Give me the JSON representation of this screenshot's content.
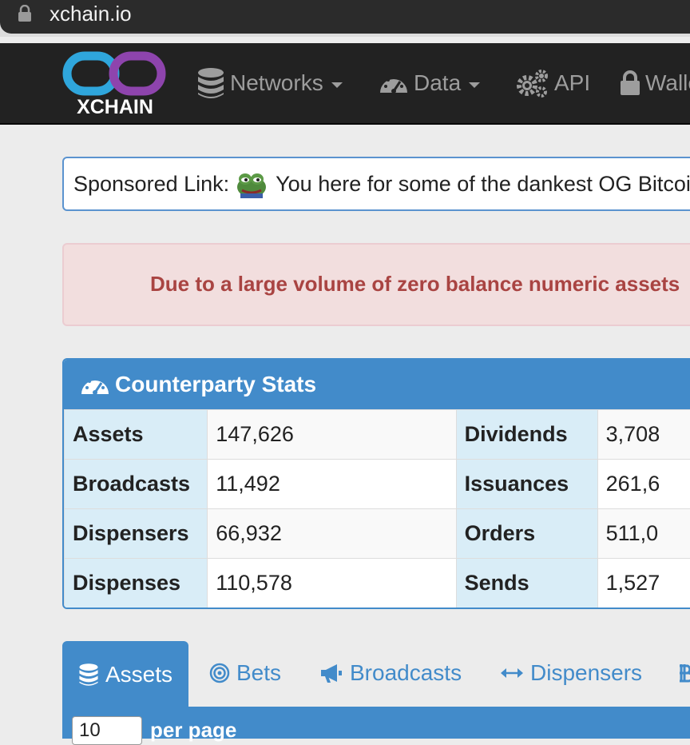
{
  "browser": {
    "url": "xchain.io"
  },
  "navbar": {
    "brand": "XCHAIN",
    "items": [
      {
        "label": "Networks",
        "icon": "database-icon",
        "dropdown": true
      },
      {
        "label": "Data",
        "icon": "dashboard-icon",
        "dropdown": true
      },
      {
        "label": "API",
        "icon": "gears-icon",
        "dropdown": false
      },
      {
        "label": "Wallet",
        "icon": "lock-icon",
        "dropdown": false
      }
    ]
  },
  "sponsored": {
    "label": "Sponsored Link:",
    "text": "You here for some of the dankest OG Bitcoin"
  },
  "alert": {
    "text": "Due to a large volume of zero balance numeric assets"
  },
  "stats": {
    "title": "Counterparty Stats",
    "rows": [
      {
        "k1": "Assets",
        "v1": "147,626",
        "k2": "Dividends",
        "v2": "3,708"
      },
      {
        "k1": "Broadcasts",
        "v1": "11,492",
        "k2": "Issuances",
        "v2": "261,6"
      },
      {
        "k1": "Dispensers",
        "v1": "66,932",
        "k2": "Orders",
        "v2": "511,0"
      },
      {
        "k1": "Dispenses",
        "v1": "110,578",
        "k2": "Sends",
        "v2": "1,527"
      }
    ]
  },
  "tabs": [
    {
      "label": "Assets",
      "icon": "database-icon",
      "active": true
    },
    {
      "label": "Bets",
      "icon": "bullseye-icon",
      "active": false
    },
    {
      "label": "Broadcasts",
      "icon": "bullhorn-icon",
      "active": false
    },
    {
      "label": "Dispensers",
      "icon": "arrows-h-icon",
      "active": false
    }
  ],
  "table_controls": {
    "per_page_value": "10",
    "per_page_label": "per page"
  },
  "colors": {
    "primary": "#428bca",
    "navbar": "#222222",
    "alert_text": "#a94442"
  }
}
